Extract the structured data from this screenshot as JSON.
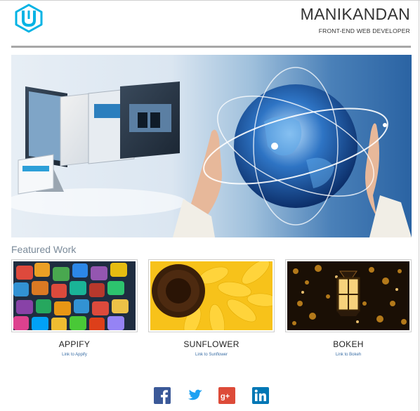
{
  "header": {
    "name": "MANIKANDAN",
    "role": "FRONT-END WEB DEVELOPER",
    "logo_icon": "udacity-logo-icon",
    "accent": "#02b3e4"
  },
  "hero": {
    "image_icon": "web-devices-globe-banner"
  },
  "featured": {
    "title": "Featured Work",
    "items": [
      {
        "title": "APPIFY",
        "link": "Link to Appify",
        "image_icon": "app-icons-thumbnail"
      },
      {
        "title": "SUNFLOWER",
        "link": "Link to Sunflower",
        "image_icon": "sunflower-thumbnail"
      },
      {
        "title": "BOKEH",
        "link": "Link to Bokeh",
        "image_icon": "lantern-bokeh-thumbnail"
      }
    ]
  },
  "social": [
    {
      "name": "facebook-icon",
      "color": "#3b5998"
    },
    {
      "name": "twitter-icon",
      "color": "#1da1f2"
    },
    {
      "name": "google-plus-icon",
      "color": "#dd4b39"
    },
    {
      "name": "linkedin-icon",
      "color": "#0077b5"
    }
  ]
}
